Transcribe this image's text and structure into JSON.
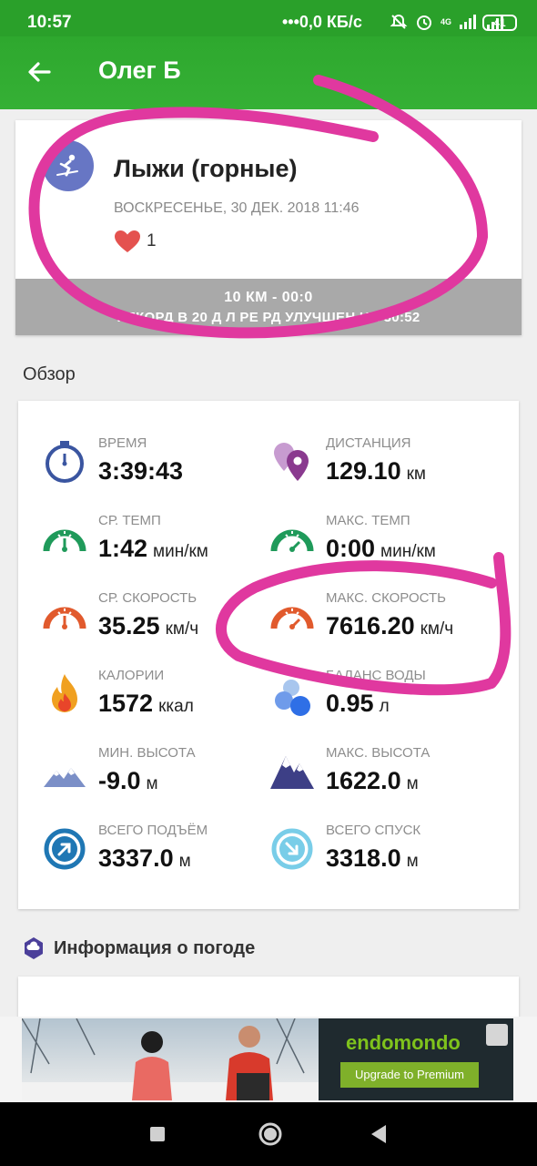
{
  "status_bar": {
    "time": "10:57",
    "network": "0,0 КБ/с",
    "signal_type": "4G",
    "battery": "41"
  },
  "app_bar": {
    "title": "Олег Б",
    "back_icon": "arrow-left-icon"
  },
  "workout": {
    "sport_icon": "skier-icon",
    "sport": "Лыжи (горные)",
    "date": "ВОСКРЕСЕНЬЕ, 30 ДЕК. 2018 11:46",
    "likes": "1",
    "record_line1": "10 КМ  -  00:0",
    "record_line2": "РЕКОРД В 20  Д Л РЕ   РД УЛУЧШЕН НА 30:52"
  },
  "overview": {
    "title": "Обзор",
    "stats": [
      {
        "label": "ВРЕМЯ",
        "value": "3:39:43",
        "unit": "",
        "icon": "stopwatch-icon"
      },
      {
        "label": "ДИСТАНЦИЯ",
        "value": "129.10",
        "unit": "км",
        "icon": "map-pins-icon"
      },
      {
        "label": "СР. ТЕМП",
        "value": "1:42",
        "unit": "мин/км",
        "icon": "green-gauge-icon"
      },
      {
        "label": "МАКС. ТЕМП",
        "value": "0:00",
        "unit": "мин/км",
        "icon": "green-gauge-icon"
      },
      {
        "label": "СР. СКОРОСТЬ",
        "value": "35.25",
        "unit": "км/ч",
        "icon": "orange-gauge-icon"
      },
      {
        "label": "МАКС. СКОРОСТЬ",
        "value": "7616.20",
        "unit": "км/ч",
        "icon": "orange-gauge-icon"
      },
      {
        "label": "КАЛОРИИ",
        "value": "1572",
        "unit": "ккал",
        "icon": "flame-icon"
      },
      {
        "label": "БАЛАНС ВОДЫ",
        "value": "0.95",
        "unit": "л",
        "icon": "water-drops-icon"
      },
      {
        "label": "МИН. ВЫСОТА",
        "value": "-9.0",
        "unit": "м",
        "icon": "low-mountain-icon"
      },
      {
        "label": "МАКС. ВЫСОТА",
        "value": "1622.0",
        "unit": "м",
        "icon": "high-mountain-icon"
      },
      {
        "label": "ВСЕГО ПОДЪЁМ",
        "value": "3337.0",
        "unit": "м",
        "icon": "ascent-icon"
      },
      {
        "label": "ВСЕГО СПУСК",
        "value": "3318.0",
        "unit": "м",
        "icon": "descent-icon"
      }
    ]
  },
  "weather": {
    "title": "Информация о погоде",
    "icon": "weather-hexagon-icon"
  },
  "ad": {
    "brand": "endomondo",
    "cta": "Upgrade to Premium"
  },
  "colors": {
    "header_green": "#2ea82e",
    "annotation_pink": "#e0389f",
    "record_gray": "#a9a9a9"
  }
}
